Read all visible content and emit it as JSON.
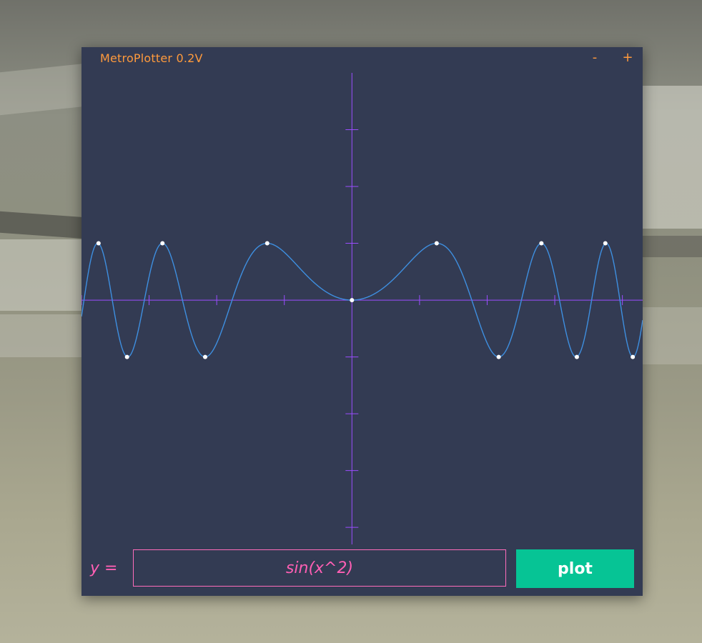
{
  "window": {
    "title": "MetroPlotter 0.2V",
    "minimize_label": "-",
    "maximize_label": "+"
  },
  "input": {
    "prefix_label": "y =",
    "expression": "sin(x^2)"
  },
  "plot_button": {
    "label": "plot"
  },
  "colors": {
    "window_bg": "#333b53",
    "title": "#ff9a3c",
    "axes": "#9b4dff",
    "curve": "#3e8fe0",
    "points": "#ffffff",
    "input_text": "#ff5fb4",
    "button_bg": "#06c495"
  },
  "chart_data": {
    "type": "line",
    "function": "sin(x^2)",
    "xlim": [
      -4,
      4.3
    ],
    "ylim": [
      -4.3,
      4
    ],
    "x_ticks": [
      -4,
      -3,
      -2,
      -1,
      1,
      2,
      3,
      4
    ],
    "y_ticks": [
      -4,
      -3,
      -2,
      -1,
      1,
      2,
      3
    ],
    "grid": false,
    "marked_points": [
      {
        "x": -3.7478,
        "y": 1
      },
      {
        "x": -3.3265,
        "y": -1
      },
      {
        "x": -2.8024,
        "y": 1
      },
      {
        "x": -2.1708,
        "y": -1
      },
      {
        "x": -1.2533,
        "y": 1
      },
      {
        "x": 0,
        "y": 0
      },
      {
        "x": 1.2533,
        "y": 1
      },
      {
        "x": 2.1708,
        "y": -1
      },
      {
        "x": 2.8024,
        "y": 1
      },
      {
        "x": 3.3265,
        "y": -1
      },
      {
        "x": 3.7478,
        "y": 1
      },
      {
        "x": 4.1536,
        "y": -1
      }
    ]
  }
}
